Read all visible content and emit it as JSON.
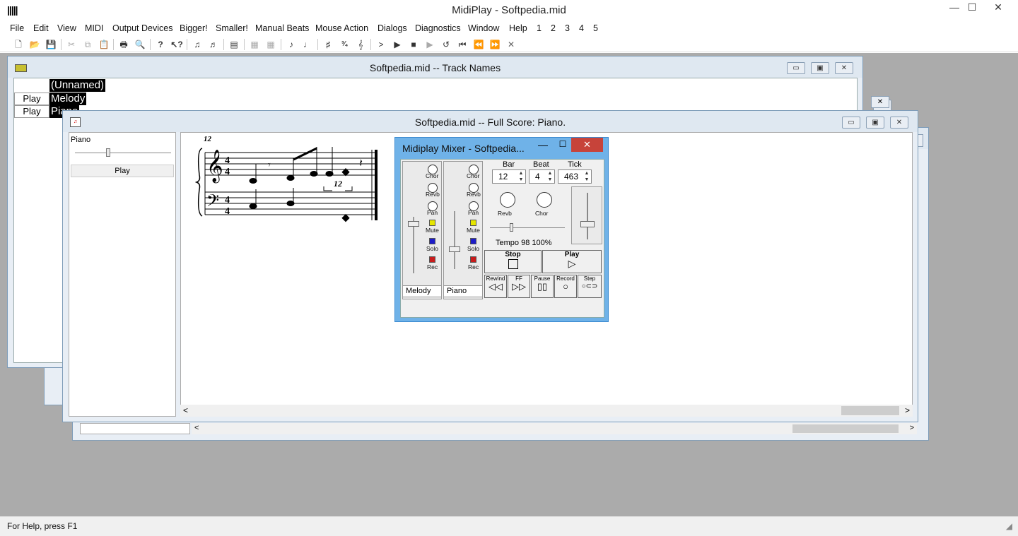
{
  "app": {
    "title": "MidiPlay - Softpedia.mid",
    "icon": "piano-keys-icon",
    "controls": {
      "minimize": "—",
      "maximize": "☐",
      "close": "✕"
    }
  },
  "menu": [
    "File",
    "Edit",
    "View",
    "MIDI",
    "Output Devices",
    "Bigger!",
    "Smaller!",
    "Manual Beats",
    "Mouse Action",
    "Dialogs",
    "Diagnostics",
    "Window",
    "Help",
    "1",
    "2",
    "3",
    "4",
    "5"
  ],
  "toolbar": {
    "icons": [
      "new-file-icon",
      "open-folder-icon",
      "save-icon",
      "cut-icon",
      "copy-icon",
      "paste-icon",
      "print-icon",
      "print-preview-icon",
      "help-icon",
      "context-help-icon",
      "notes-view-icon",
      "notes-view-2-icon",
      "bar-icon",
      "measures-icon",
      "measures-2-icon",
      "score-icon",
      "score-2-icon",
      "sharp-icon",
      "time-sig-icon",
      "tempo-icon",
      "step-icon",
      "play-icon",
      "stop-icon",
      "next-icon",
      "loop-icon",
      "rewind-start-icon",
      "rewind-icon",
      "fast-forward-icon",
      "close-icon"
    ]
  },
  "track_names_window": {
    "title": "Softpedia.mid -- Track Names",
    "rows": [
      {
        "play": "",
        "name": "(Unnamed)"
      },
      {
        "play": "Play",
        "name": "Melody"
      },
      {
        "play": "Play",
        "name": "Piano"
      }
    ]
  },
  "full_score_window": {
    "title": "Softpedia.mid -- Full Score: Piano.",
    "track_label": "Piano",
    "play_button": "Play",
    "bar_number": "12",
    "tuplet": "12"
  },
  "mixer": {
    "title": "Midiplay Mixer - Softpedia...",
    "strips": [
      {
        "name": "Melody",
        "chor": "Chor",
        "revb": "Revb",
        "pan": "Pan",
        "mute": "Mute",
        "solo": "Solo",
        "rec": "Rec"
      },
      {
        "name": "Piano",
        "chor": "Chor",
        "revb": "Revb",
        "pan": "Pan",
        "mute": "Mute",
        "solo": "Solo",
        "rec": "Rec"
      }
    ],
    "position": {
      "bar_label": "Bar",
      "bar": "12",
      "beat_label": "Beat",
      "beat": "4",
      "tick_label": "Tick",
      "tick": "463"
    },
    "master": {
      "revb": "Revb",
      "chor": "Chor",
      "tempo": "Tempo 98 100%"
    },
    "transport": {
      "stop": "Stop",
      "play": "Play",
      "rewind": "Rewind",
      "ff": "FF",
      "pause": "Pause",
      "record": "Record",
      "step": "Step"
    }
  },
  "status": {
    "text": "For Help, press F1"
  },
  "colors": {
    "mdi_bg": "#ababab",
    "mixer_title": "#6fb2e8",
    "close_red": "#c7433a",
    "mute": "#e6e600",
    "solo": "#1c1cc8",
    "rec": "#c81c1c"
  }
}
